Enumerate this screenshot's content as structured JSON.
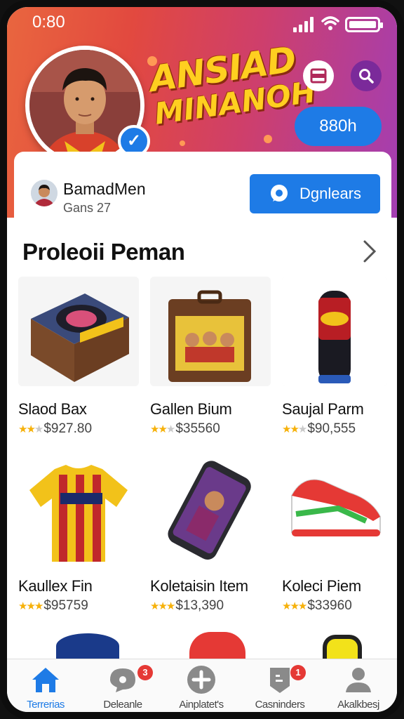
{
  "status_bar": {
    "time": "0:80"
  },
  "header": {
    "brand_line1": "ANSIAD",
    "brand_line2": "MINANOH",
    "pill_label": "880h"
  },
  "profile": {
    "name": "BamadMen",
    "subtitle": "Gans 27",
    "action_label": "Dgnlears"
  },
  "section": {
    "title": "Proleoii Peman"
  },
  "products": [
    {
      "name": "Slaod Bax",
      "price": "$927.80",
      "rating": 2
    },
    {
      "name": "Gallen Bium",
      "price": "$35560",
      "rating": 2
    },
    {
      "name": "Saujal Parm",
      "price": "$90,555",
      "rating": 2
    },
    {
      "name": "Kaullex Fin",
      "price": "$95759",
      "rating": 3
    },
    {
      "name": "Koletaisin Item",
      "price": "$13,390",
      "rating": 3
    },
    {
      "name": "Koleci Piem",
      "price": "$33960",
      "rating": 3
    }
  ],
  "tabs": [
    {
      "label": "Terrerias",
      "icon": "home-icon",
      "active": true
    },
    {
      "label": "Deleanle",
      "icon": "chat-icon",
      "badge": "3"
    },
    {
      "label": "Ainplatet's",
      "icon": "plus-icon"
    },
    {
      "label": "Casninders",
      "icon": "tag-icon",
      "badge": "1"
    },
    {
      "label": "Akalkbesj",
      "icon": "user-icon"
    }
  ],
  "colors": {
    "accent": "#1e7be6",
    "star": "#f6b10a",
    "badge": "#e53935"
  }
}
